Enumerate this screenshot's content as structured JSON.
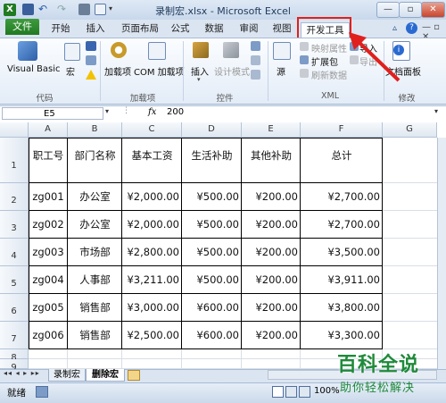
{
  "titlebar": {
    "title": "录制宏.xlsx - Microsoft Excel"
  },
  "tabs": {
    "file": "文件",
    "items": [
      "开始",
      "插入",
      "页面布局",
      "公式",
      "数据",
      "审阅",
      "视图",
      "开发工具"
    ]
  },
  "ribbon": {
    "code": {
      "label": "代码",
      "visual_basic": "Visual Basic",
      "macros": "宏"
    },
    "addins": {
      "label": "加载项",
      "addins": "加载项",
      "com_addins": "COM 加载项"
    },
    "controls": {
      "label": "控件",
      "insert": "插入",
      "design_mode": "设计模式"
    },
    "source": {
      "label": "源"
    },
    "xml": {
      "label": "XML",
      "map_properties": "映射属性",
      "expansion_packs": "扩展包",
      "refresh_data": "刷新数据",
      "import": "导入",
      "export": "导出"
    },
    "modify": {
      "label": "修改",
      "document_panel": "文档面板"
    }
  },
  "formula_bar": {
    "name_box": "E5",
    "fx": "fx",
    "value": "200"
  },
  "columns": [
    "A",
    "B",
    "C",
    "D",
    "E",
    "F",
    "G"
  ],
  "rows": [
    "1",
    "2",
    "3",
    "4",
    "5",
    "6",
    "7",
    "8",
    "9"
  ],
  "table": {
    "headers": [
      "职工号",
      "部门名称",
      "基本工资",
      "生活补助",
      "其他补助",
      "总计"
    ],
    "rows": [
      [
        "zg001",
        "办公室",
        "¥2,000.00",
        "¥500.00",
        "¥200.00",
        "¥2,700.00"
      ],
      [
        "zg002",
        "办公室",
        "¥2,000.00",
        "¥500.00",
        "¥200.00",
        "¥2,700.00"
      ],
      [
        "zg003",
        "市场部",
        "¥2,800.00",
        "¥500.00",
        "¥200.00",
        "¥3,500.00"
      ],
      [
        "zg004",
        "人事部",
        "¥3,211.00",
        "¥500.00",
        "¥200.00",
        "¥3,911.00"
      ],
      [
        "zg005",
        "销售部",
        "¥3,000.00",
        "¥600.00",
        "¥200.00",
        "¥3,800.00"
      ],
      [
        "zg006",
        "销售部",
        "¥2,500.00",
        "¥600.00",
        "¥200.00",
        "¥3,300.00"
      ]
    ]
  },
  "sheets": [
    "录制宏",
    "删除宏"
  ],
  "status": {
    "ready": "就绪",
    "zoom": "100%"
  },
  "watermark": {
    "title": "百科全说",
    "subtitle": "助你轻松解决"
  },
  "colors": {
    "excel_green": "#217a21",
    "highlight_red": "#e0201c",
    "arrow_red": "#e0201c"
  }
}
